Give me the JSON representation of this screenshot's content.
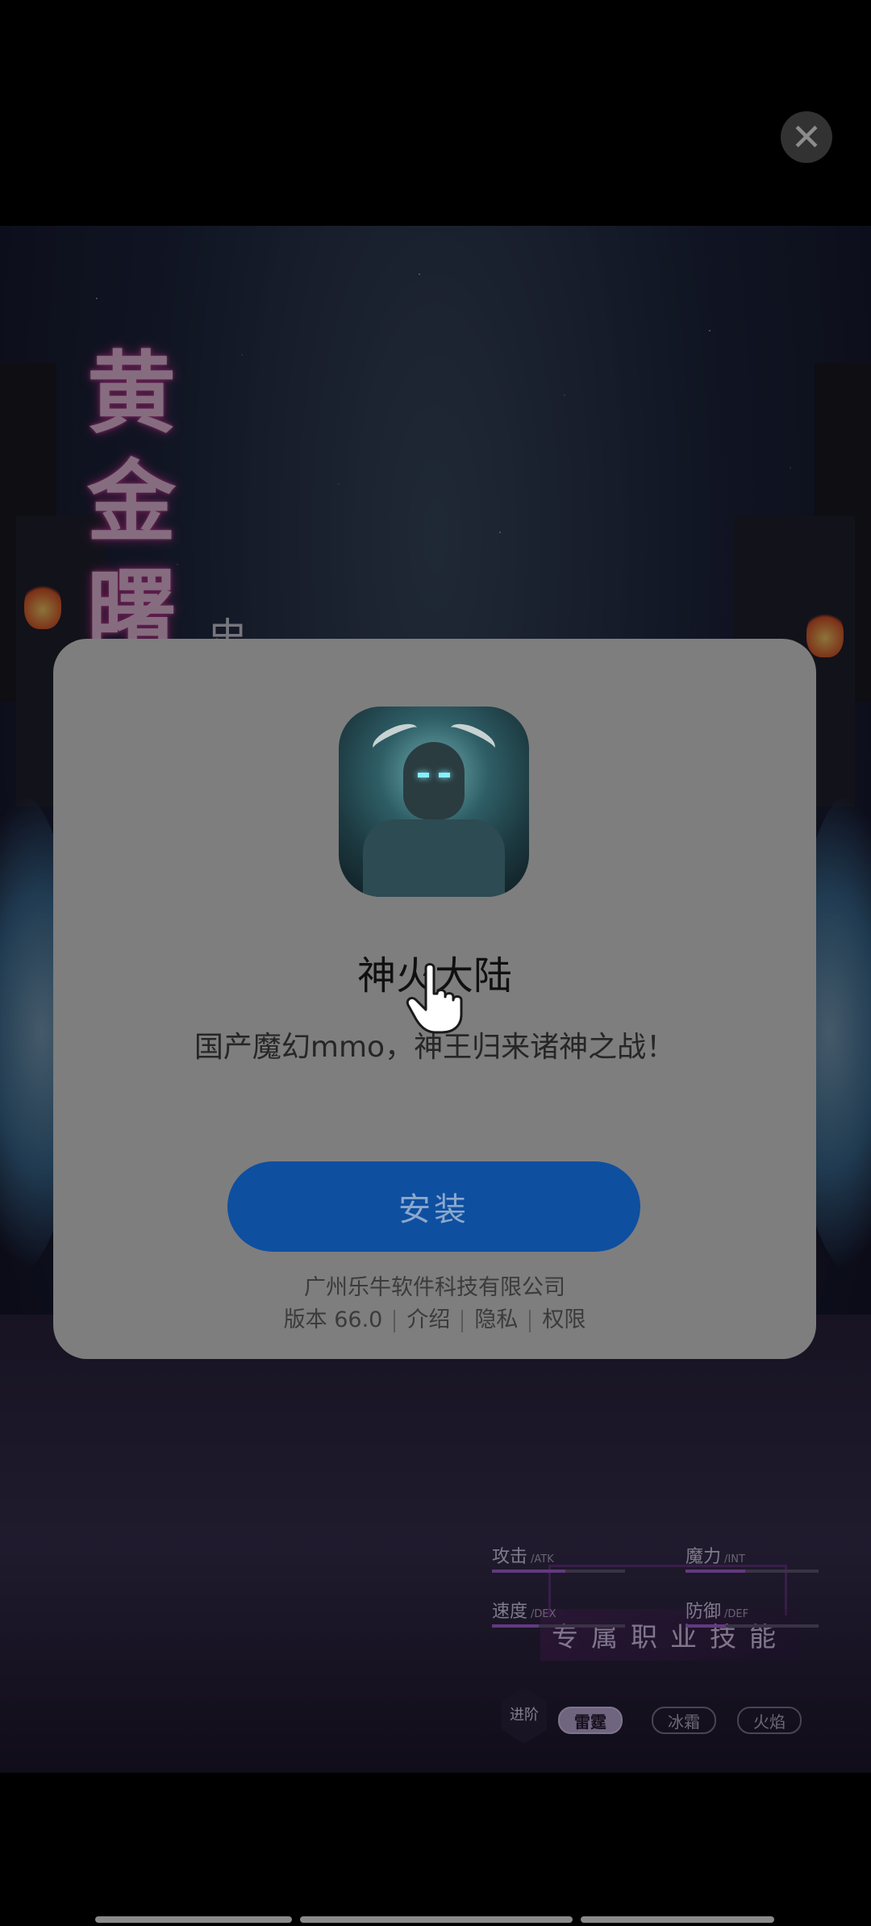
{
  "close": {
    "glyph": "✕"
  },
  "background": {
    "game_title_chars": [
      "黄",
      "金",
      "曙"
    ],
    "title_fragment": "史",
    "skill_heading": "专属职业技能",
    "advance_label": "进阶",
    "element_tabs": [
      "雷霆",
      "冰霜",
      "火焰"
    ],
    "stats": [
      {
        "label": "攻击",
        "abbr": "/ATK",
        "level": 0.55
      },
      {
        "label": "魔力",
        "abbr": "/INT",
        "level": 0.45
      },
      {
        "label": "速度",
        "abbr": "/DEX",
        "level": 0.35
      },
      {
        "label": "防御",
        "abbr": "/DEF",
        "level": 0.3
      }
    ]
  },
  "dialog": {
    "app_icon": "armored-horned-knight-icon",
    "app_name": "神火大陆",
    "app_description": "国产魔幻mmo，神王归来诸神之战！",
    "install_label": "安装",
    "developer": "广州乐牛软件科技有限公司",
    "version": "版本 66.0",
    "links": [
      "介绍",
      "隐私",
      "权限"
    ]
  },
  "colors": {
    "dialog_bg": "#7e7e7e",
    "install_button": "#0f4fa0",
    "install_text": "#8aa8cc",
    "close_button": "#5b5b5b"
  }
}
